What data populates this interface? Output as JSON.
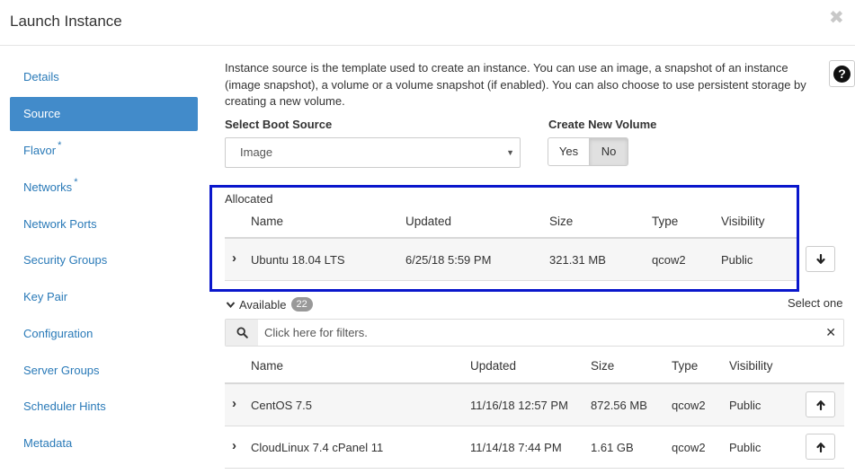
{
  "modal": {
    "title": "Launch Instance",
    "close_glyph": "✖"
  },
  "sidebar": {
    "items": [
      {
        "label": "Details",
        "required": false,
        "active": false
      },
      {
        "label": "Source",
        "required": false,
        "active": true
      },
      {
        "label": "Flavor",
        "required": true,
        "active": false
      },
      {
        "label": "Networks",
        "required": true,
        "active": false
      },
      {
        "label": "Network Ports",
        "required": false,
        "active": false
      },
      {
        "label": "Security Groups",
        "required": false,
        "active": false
      },
      {
        "label": "Key Pair",
        "required": false,
        "active": false
      },
      {
        "label": "Configuration",
        "required": false,
        "active": false
      },
      {
        "label": "Server Groups",
        "required": false,
        "active": false
      },
      {
        "label": "Scheduler Hints",
        "required": false,
        "active": false
      },
      {
        "label": "Metadata",
        "required": false,
        "active": false
      }
    ],
    "required_mark": "*"
  },
  "help": {
    "glyph": "?"
  },
  "source": {
    "description": "Instance source is the template used to create an instance. You can use an image, a snapshot of an instance (image snapshot), a volume or a volume snapshot (if enabled). You can also choose to use persistent storage by creating a new volume.",
    "boot_source_label": "Select Boot Source",
    "boot_source_value": "Image",
    "create_volume_label": "Create New Volume",
    "yes_label": "Yes",
    "no_label": "No",
    "selected_volume_option": "No"
  },
  "allocated": {
    "label": "Allocated",
    "columns": [
      "Name",
      "Updated",
      "Size",
      "Type",
      "Visibility"
    ],
    "rows": [
      {
        "name": "Ubuntu 18.04 LTS",
        "updated": "6/25/18 5:59 PM",
        "size": "321.31 MB",
        "type": "qcow2",
        "visibility": "Public"
      }
    ]
  },
  "available": {
    "label": "Available",
    "count": "22",
    "select_hint": "Select one",
    "filter_placeholder": "Click here for filters.",
    "columns": [
      "Name",
      "Updated",
      "Size",
      "Type",
      "Visibility"
    ],
    "rows": [
      {
        "name": "CentOS 7.5",
        "updated": "11/16/18 12:57 PM",
        "size": "872.56 MB",
        "type": "qcow2",
        "visibility": "Public"
      },
      {
        "name": "CloudLinux 7.4 cPanel 11",
        "updated": "11/14/18 7:44 PM",
        "size": "1.61 GB",
        "type": "qcow2",
        "visibility": "Public"
      }
    ]
  },
  "colors": {
    "accent": "#428bca",
    "link": "#2a7ab8",
    "highlight_border": "#0a17cc"
  }
}
